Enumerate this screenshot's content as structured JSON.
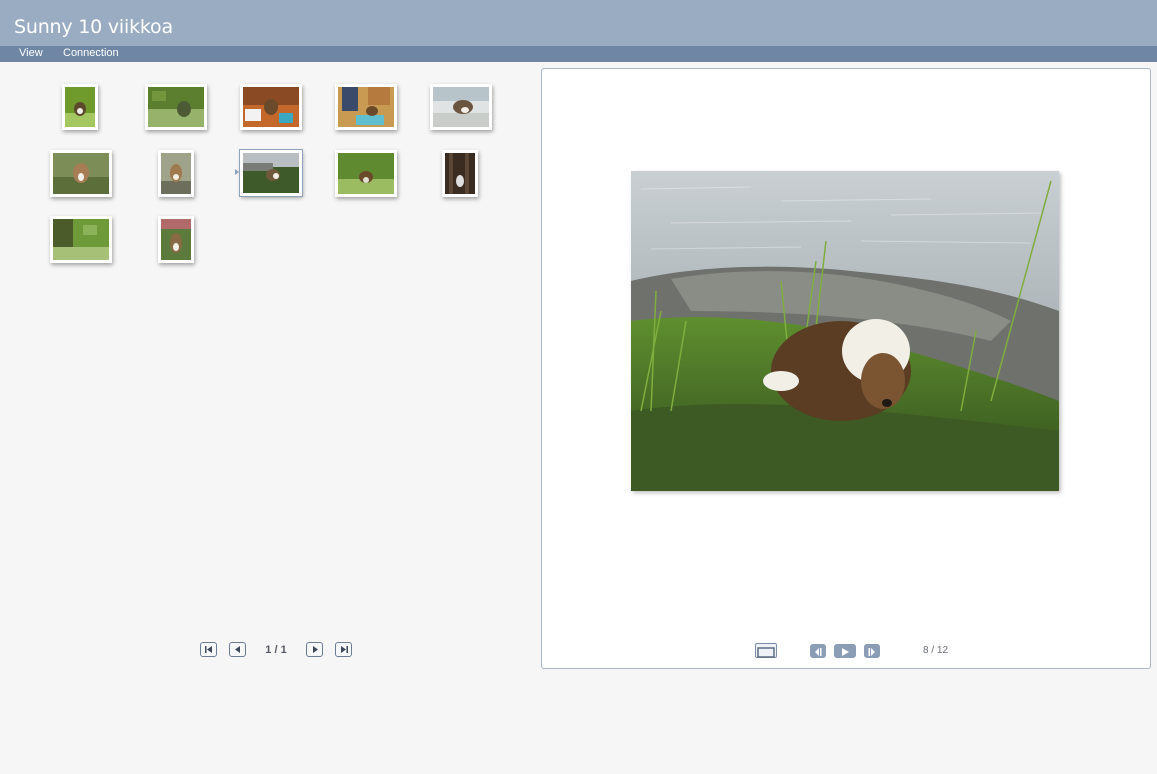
{
  "app": {
    "title": "Sunny 10 viikkoa"
  },
  "menu": {
    "items": [
      "View",
      "Connection"
    ]
  },
  "thumbnails": [
    {
      "index": 1,
      "colors": [
        "#6f9a2c",
        "#a5c760",
        "#5d4a2c"
      ]
    },
    {
      "index": 2,
      "colors": [
        "#5b7f2e",
        "#97b36b",
        "#4d5b34"
      ]
    },
    {
      "index": 3,
      "colors": [
        "#c4672a",
        "#8a4a24",
        "#f2f2f2"
      ]
    },
    {
      "index": 4,
      "colors": [
        "#3a4a6a",
        "#c89a52",
        "#5fbfd0"
      ]
    },
    {
      "index": 5,
      "colors": [
        "#b7c4c9",
        "#dfe3e4",
        "#6b5440"
      ]
    },
    {
      "index": 6,
      "colors": [
        "#7d8d58",
        "#a67d55",
        "#5c6e3a"
      ]
    },
    {
      "index": 7,
      "colors": [
        "#9fa38a",
        "#a07a4c",
        "#6d6e5b"
      ]
    },
    {
      "index": 8,
      "colors": [
        "#b8bec2",
        "#3f5a2a",
        "#6e5a3a"
      ],
      "selected": true
    },
    {
      "index": 9,
      "colors": [
        "#5f8a2f",
        "#9cbc62",
        "#e0e0d0"
      ]
    },
    {
      "index": 10,
      "colors": [
        "#3b2c22",
        "#5a4634",
        "#dedede"
      ]
    },
    {
      "index": 11,
      "colors": [
        "#6e9a3a",
        "#a6c077",
        "#4b5b2a"
      ]
    },
    {
      "index": 12,
      "colors": [
        "#5b7a3c",
        "#b06a6a",
        "#8a6a44"
      ]
    }
  ],
  "pagination": {
    "current": "1",
    "separator": "/",
    "total": "1",
    "label": "1 / 1"
  },
  "viewer": {
    "counter": "8 / 12",
    "photo_colors": {
      "water": "#9aa6ad",
      "rock": "#7a7c78",
      "grass": "#4c7a2a",
      "moss": "#3e5a24",
      "puppy": "#6b4a2c",
      "puppy_white": "#f2efe7"
    }
  },
  "icons": {
    "first": "first-page-icon",
    "prev": "previous-page-icon",
    "next": "next-page-icon",
    "last": "last-page-icon",
    "fullscreen": "fullscreen-icon",
    "prev_photo": "previous-photo-icon",
    "play": "play-slideshow-icon",
    "next_photo": "next-photo-icon"
  }
}
